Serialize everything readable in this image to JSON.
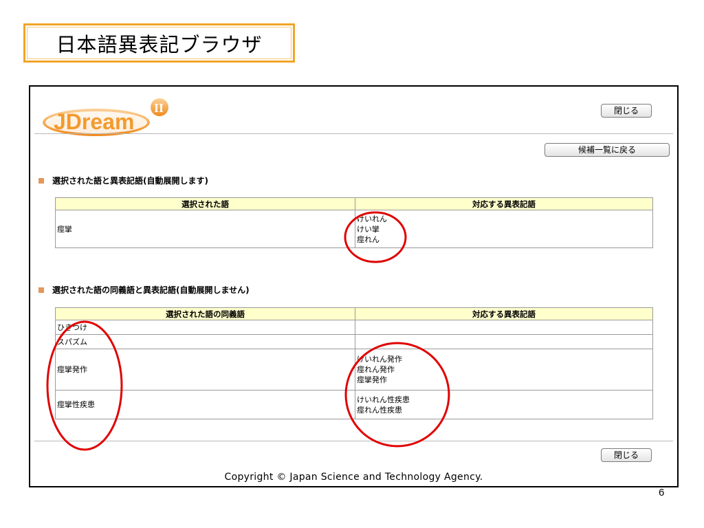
{
  "slide": {
    "title": "日本語異表記ブラウザ",
    "page_number": "6"
  },
  "app": {
    "logo_text": "JDream",
    "logo_mark": "II",
    "close_label": "閉じる",
    "back_label": "候補一覧に戻る",
    "copyright": "Copyright © Japan Science and Technology Agency."
  },
  "section1": {
    "title": "選択された語と異表記語(自動展開します)",
    "col_term": "選択された語",
    "col_variants": "対応する異表記語",
    "term": "痙攣",
    "variants": [
      "けいれん",
      "けい攣",
      "痙れん"
    ]
  },
  "section2": {
    "title": "選択された語の同義語と異表記語(自動展開しません)",
    "col_term": "選択された語の同義語",
    "col_variants": "対応する異表記語",
    "rows": [
      {
        "term": "ひきつけ",
        "variants": []
      },
      {
        "term": "スパズム",
        "variants": []
      },
      {
        "term": "痙攣発作",
        "variants": [
          "けいれん発作",
          "痙れん発作",
          "痙攣発作"
        ]
      },
      {
        "term": "痙攣性疾患",
        "variants": [
          "けいれん性疾患",
          "痙れん性疾患"
        ]
      }
    ]
  },
  "colors": {
    "title_border": "#f2a427",
    "header_bg": "#ffffcc",
    "bullet": "#e4975c",
    "annotation": "#e00000",
    "logo": "#f39a2e"
  }
}
